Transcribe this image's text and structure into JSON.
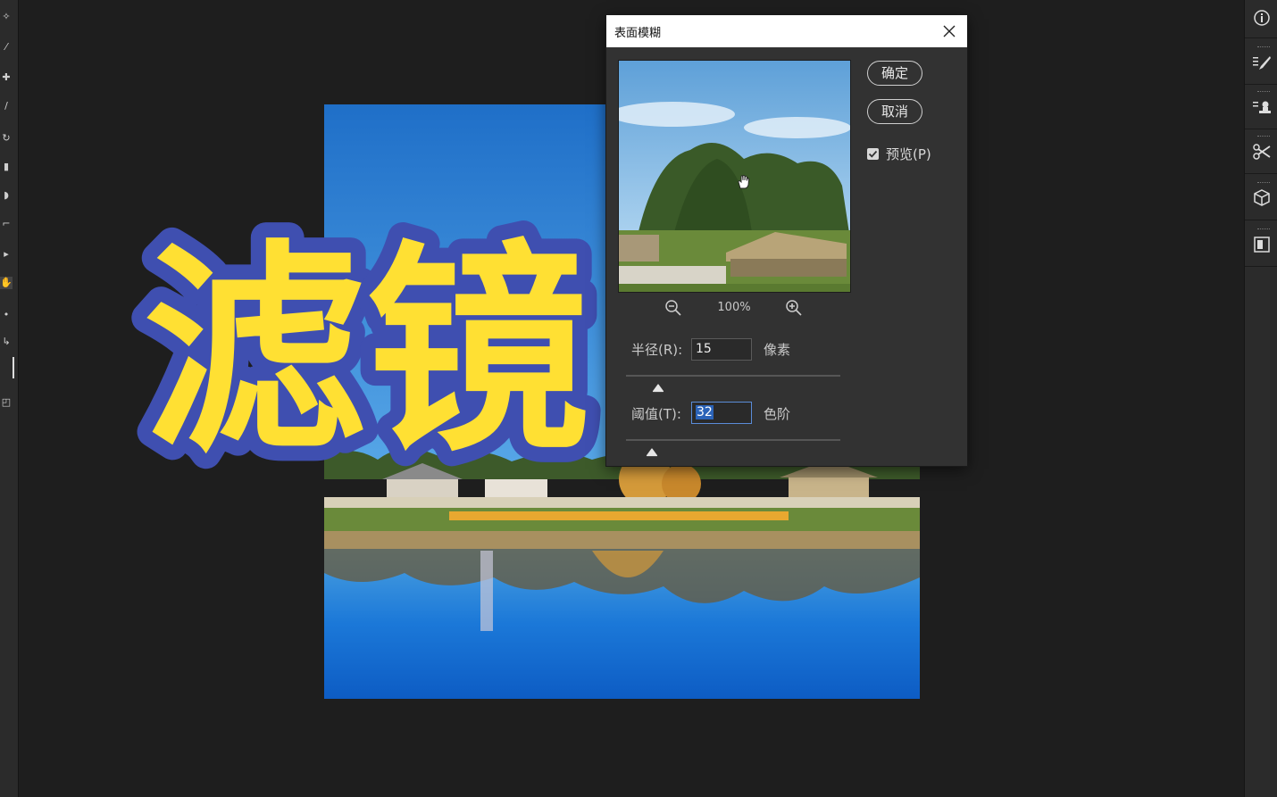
{
  "colors": {
    "workspace_bg": "#1e1e1e",
    "panel_bg": "#2b2b2b",
    "dialog_bg": "#323232",
    "title_fill": "#ffe033",
    "title_stroke": "#3f4fb0",
    "accent": "#5a8cd8"
  },
  "canvas": {
    "title_text": "滤镜"
  },
  "left_toolbar": {
    "tools": [
      "magic-wand-icon",
      "brush-icon",
      "healing-icon",
      "pencil-icon",
      "history-brush-icon",
      "eraser-icon",
      "smudge-icon",
      "pen-icon",
      "path-select-icon",
      "hand-icon",
      "zoom-icon",
      "swap-icon",
      "color-swatch-icon",
      "screen-mode-icon"
    ]
  },
  "right_panel": {
    "buttons": [
      "info-icon",
      "brush-settings-icon",
      "clone-source-icon",
      "tool-presets-icon",
      "3d-icon",
      "layer-comps-icon"
    ]
  },
  "dialog": {
    "title": "表面模糊",
    "ok_label": "确定",
    "cancel_label": "取消",
    "preview_label": "预览(P)",
    "preview_checked": true,
    "zoom_level": "100%",
    "radius": {
      "label": "半径(R):",
      "value": "15",
      "unit": "像素",
      "slider_fraction": 0.15
    },
    "threshold": {
      "label": "阈值(T):",
      "value": "32",
      "unit": "色阶",
      "slider_fraction": 0.12
    }
  }
}
